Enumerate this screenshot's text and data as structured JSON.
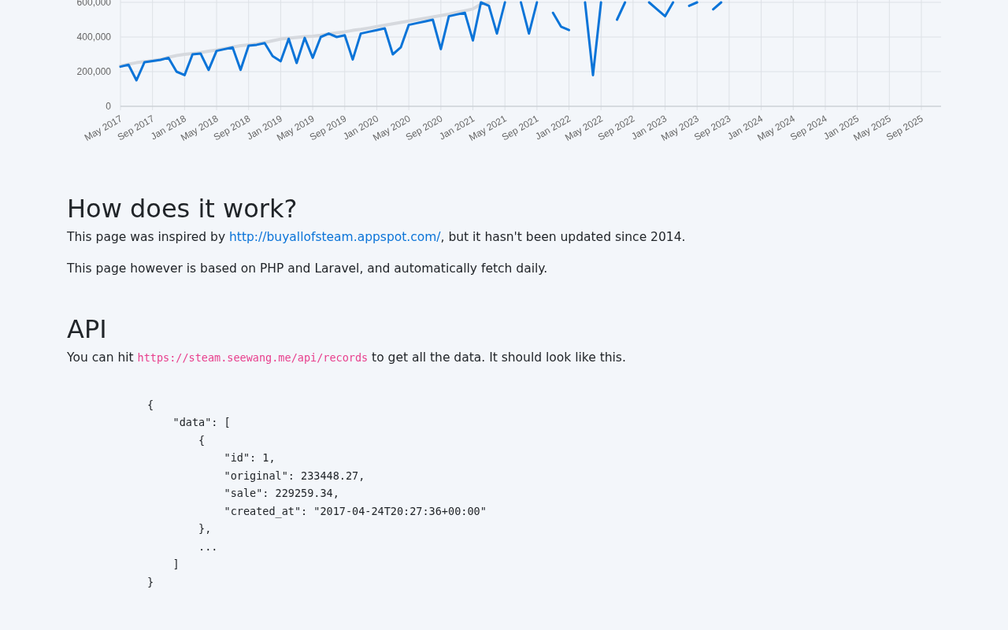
{
  "chart": {
    "chart_data": {
      "type": "line",
      "categories": [
        "May 2017",
        null,
        null,
        null,
        "Sep 2017",
        null,
        null,
        null,
        "Jan 2018",
        null,
        null,
        null,
        "May 2018",
        null,
        null,
        null,
        "Sep 2018",
        null,
        null,
        null,
        "Jan 2019",
        null,
        null,
        null,
        "May 2019",
        null,
        null,
        null,
        "Sep 2019",
        null,
        null,
        null,
        "Jan 2020",
        null,
        null,
        null,
        "May 2020",
        null,
        null,
        null,
        "Sep 2020",
        null,
        null,
        null,
        "Jan 2021",
        null,
        null,
        null,
        "May 2021",
        null,
        null,
        null,
        "Sep 2021",
        null,
        null,
        null,
        "Jan 2022",
        null,
        null,
        null,
        "May 2022",
        null,
        null,
        null,
        "Sep 2022",
        null,
        null,
        null,
        "Jan 2023",
        null,
        null,
        null,
        "May 2023",
        null,
        null,
        null,
        "Sep 2023",
        null,
        null,
        null,
        "Jan 2024",
        null,
        null,
        null,
        "May 2024",
        null,
        null,
        null,
        "Sep 2024",
        null,
        null,
        null,
        "Jan 2025",
        null,
        null,
        null,
        "May 2025",
        null,
        null,
        null,
        "Sep 2025"
      ],
      "ylim": [
        0,
        600000
      ],
      "grid": true,
      "yticks": [
        {
          "value": 0,
          "label": "0"
        },
        {
          "value": 200000,
          "label": "200,000"
        },
        {
          "value": 400000,
          "label": "400,000"
        },
        {
          "value": 600000,
          "label": "600,000"
        }
      ],
      "series": [
        {
          "color": "#d6d9de",
          "values": [
            233000,
            243000,
            252000,
            258000,
            264000,
            270000,
            283000,
            293000,
            300000,
            305000,
            310000,
            318000,
            325000,
            333000,
            342000,
            350000,
            355000,
            360000,
            368000,
            378000,
            388000,
            393000,
            398000,
            402000,
            405000,
            410000,
            418000,
            424000,
            430000,
            438000,
            444000,
            452000,
            460000,
            468000,
            476000,
            484000,
            492000,
            500000,
            508000,
            516000,
            524000,
            532000,
            542000,
            552000,
            562000,
            590000,
            598000,
            null,
            null,
            null,
            null,
            null,
            null,
            null,
            null,
            null,
            null,
            null,
            null,
            null,
            null,
            null,
            null,
            null,
            null,
            null,
            null,
            null,
            null,
            null,
            null,
            null,
            null,
            null,
            null,
            null,
            null,
            null,
            null,
            null,
            null,
            null,
            null,
            null,
            null,
            null,
            null,
            null,
            null,
            null,
            null,
            null,
            null,
            null,
            null,
            null,
            null,
            null,
            null,
            null,
            null
          ]
        },
        {
          "color": "#0b74d8",
          "values": [
            229000,
            240000,
            150000,
            255000,
            262000,
            268000,
            280000,
            200000,
            180000,
            300000,
            305000,
            210000,
            320000,
            330000,
            340000,
            210000,
            350000,
            355000,
            365000,
            290000,
            260000,
            390000,
            250000,
            395000,
            280000,
            400000,
            420000,
            400000,
            410000,
            270000,
            420000,
            430000,
            440000,
            450000,
            300000,
            340000,
            470000,
            480000,
            490000,
            500000,
            330000,
            520000,
            530000,
            540000,
            380000,
            600000,
            580000,
            420000,
            600000,
            null,
            600000,
            420000,
            600000,
            null,
            540000,
            460000,
            440000,
            null,
            600000,
            180000,
            600000,
            null,
            500000,
            600000,
            null,
            null,
            600000,
            560000,
            520000,
            600000,
            null,
            580000,
            600000,
            null,
            560000,
            600000,
            null,
            null,
            null,
            null,
            null,
            null,
            null,
            null,
            null,
            null,
            null,
            null,
            null,
            null,
            null,
            null,
            null,
            null,
            null,
            null,
            null,
            null,
            null,
            null,
            null
          ]
        }
      ]
    }
  },
  "sections": [
    {
      "heading": "How does it work?",
      "paragraphs": [
        {
          "before": "This page was inspired by ",
          "link": "http://buyallofsteam.appspot.com/",
          "after": ", but it hasn't been updated since 2014."
        },
        {
          "before": "This page however is based on PHP and Laravel, and automatically fetch daily."
        }
      ]
    },
    {
      "heading": "API",
      "paragraphs": [
        {
          "before": "You can hit ",
          "code": "https://steam.seewang.me/api/records",
          "after": " to get all the data. It should look like this."
        }
      ],
      "code_block": "{\n    \"data\": [\n        {\n            \"id\": 1,\n            \"original\": 233448.27,\n            \"sale\": 229259.34,\n            \"created_at\": \"2017-04-24T20:27:36+00:00\"\n        },\n        ...\n    ]\n}"
    }
  ]
}
